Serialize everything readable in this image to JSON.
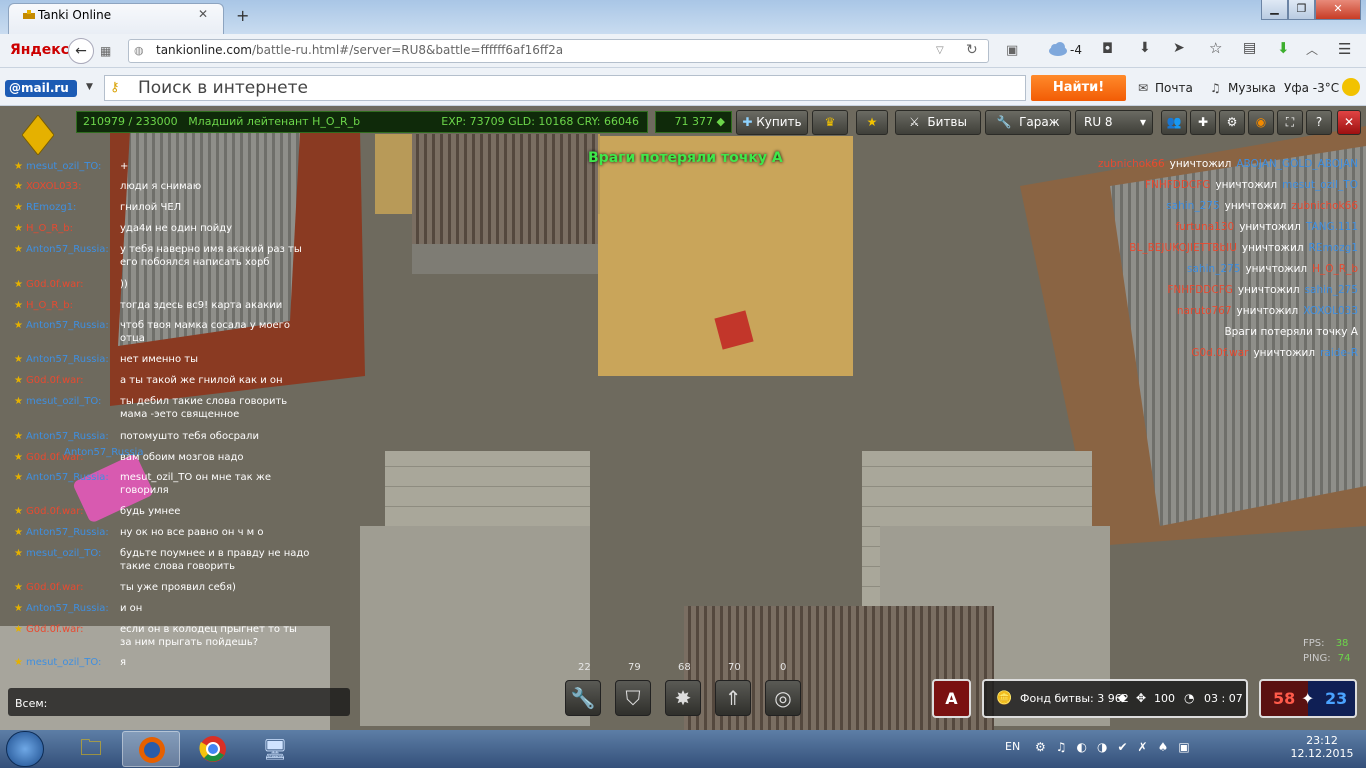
{
  "browser": {
    "tab_title": "Tanki Online",
    "url_host": "tankionline.com",
    "url_path": "/battle-ru.html#/server=RU8&battle=ffffff6af16ff2a",
    "yandex_label": "Яндекс",
    "cloud_temp": "-4"
  },
  "searchbar": {
    "mailru_label": "@mail.ru",
    "search_placeholder": "Поиск в интернете",
    "find_button": "Найти!",
    "mail_link": "Почта",
    "music_link": "Музыка",
    "weather": "Уфа -3°C"
  },
  "game": {
    "rank_progress": "210979 / 233000",
    "rank_name": "Младший лейтенант H_O_R_b",
    "exp_stats": "EXP: 73709 GLD: 10168 CRY: 66046",
    "crystals": "71 377",
    "buy_button": "Купить",
    "battles_button": "Битвы",
    "garage_button": "Гараж",
    "server": "RU 8",
    "announcement": "Враги потеряли точку А",
    "chat_input_label": "Всем:",
    "chat": [
      {
        "name": "mesut_ozil_TO:",
        "team": "blue",
        "text": "+"
      },
      {
        "name": "XOXOL033:",
        "team": "red",
        "text": "люди я снимаю"
      },
      {
        "name": "REmozg1:",
        "team": "blue",
        "text": "гнилой ЧЕЛ"
      },
      {
        "name": "H_O_R_b:",
        "team": "red",
        "text": "уда4и не один пойду"
      },
      {
        "name": "Anton57_Russia:",
        "team": "blue",
        "text": "у тебя наверно имя акакий раз ты его побоялся написать хорб"
      },
      {
        "name": "G0d.0f.war:",
        "team": "red",
        "text": "))"
      },
      {
        "name": "H_O_R_b:",
        "team": "red",
        "text": "тогда здесь вс9! карта акакии"
      },
      {
        "name": "Anton57_Russia:",
        "team": "blue",
        "text": "чтоб твоя мамка сосала у моего отца"
      },
      {
        "name": "Anton57_Russia:",
        "team": "blue",
        "text": "нет именно ты"
      },
      {
        "name": "G0d.0f.war:",
        "team": "red",
        "text": "а ты такой же гнилой как и он"
      },
      {
        "name": "mesut_ozil_TO:",
        "team": "blue",
        "text": "ты дебил такие слова говорить мама -эето священное"
      },
      {
        "name": "Anton57_Russia:",
        "team": "blue",
        "text": "потомушто тебя обосрали"
      },
      {
        "name": "G0d.0f.war:",
        "team": "red",
        "text": "вам обоим мозгов надо"
      },
      {
        "name": "Anton57_Russia:",
        "team": "blue",
        "text": "mesut_ozil_TO он мне так же говориля"
      },
      {
        "name": "G0d.0f.war:",
        "team": "red",
        "text": "будь умнее"
      },
      {
        "name": "Anton57_Russia:",
        "team": "blue",
        "text": "ну ок но все равно он ч м о"
      },
      {
        "name": "mesut_ozil_TO:",
        "team": "blue",
        "text": "будьте поумнее и в правду не надо такие слова говорить"
      },
      {
        "name": "G0d.0f.war:",
        "team": "red",
        "text": "ты уже проявил себя)"
      },
      {
        "name": "Anton57_Russia:",
        "team": "blue",
        "text": "и он"
      },
      {
        "name": "G0d.0f.war:",
        "team": "red",
        "text": "если он в колодец прыгнет то ты за ним прыгать пойдешь?"
      },
      {
        "name": "mesut_ozil_TO:",
        "team": "blue",
        "text": "я"
      }
    ],
    "killfeed": [
      {
        "killer": "zubnichok66",
        "kteam": "red",
        "victim": "ABOJAN_GOLD_ABOJAN",
        "vteam": "blue"
      },
      {
        "killer": "FNHFDDCFG",
        "kteam": "red",
        "victim": "mesut_ozil_TO",
        "vteam": "blue"
      },
      {
        "killer": "sahin_275",
        "kteam": "blue",
        "victim": "zubnichok66",
        "vteam": "red"
      },
      {
        "killer": "furtuna130",
        "kteam": "red",
        "victim": "TANG.111",
        "vteam": "blue"
      },
      {
        "killer": "BL_BEJUKOJIETTBbIU",
        "kteam": "red",
        "victim": "REmozg1",
        "vteam": "blue"
      },
      {
        "killer": "sahin_275",
        "kteam": "blue",
        "victim": "H_O_R_b",
        "vteam": "red"
      },
      {
        "killer": "FNHFDDCFG",
        "kteam": "red",
        "victim": "sahin_275",
        "vteam": "blue"
      },
      {
        "killer": "naruto767",
        "kteam": "red",
        "victim": "XOXOL033",
        "vteam": "blue"
      },
      {
        "message": "Враги потеряли точку А"
      },
      {
        "killer": "G0d.0f.war",
        "kteam": "red",
        "victim": "raide-R",
        "vteam": "blue"
      }
    ],
    "kill_word": "уничтожил",
    "supplies": [
      "22",
      "79",
      "68",
      "70",
      "0"
    ],
    "flag": "A",
    "fund_label": "Фонд битвы: 3 962",
    "players": "100",
    "timer": "03 : 07",
    "score_red": "58",
    "score_blue": "23",
    "fps_label": "FPS:",
    "fps_value": "38",
    "ping_label": "PING:",
    "ping_value": "74",
    "tank_label": "Anton57_Russia"
  },
  "taskbar": {
    "lang": "EN",
    "time": "23:12",
    "date": "12.12.2015"
  },
  "colors": {
    "blue_team": "#3f8fe0",
    "red_team": "#e84a30",
    "announce": "#3fe84a",
    "find_button": "#f25c05"
  }
}
